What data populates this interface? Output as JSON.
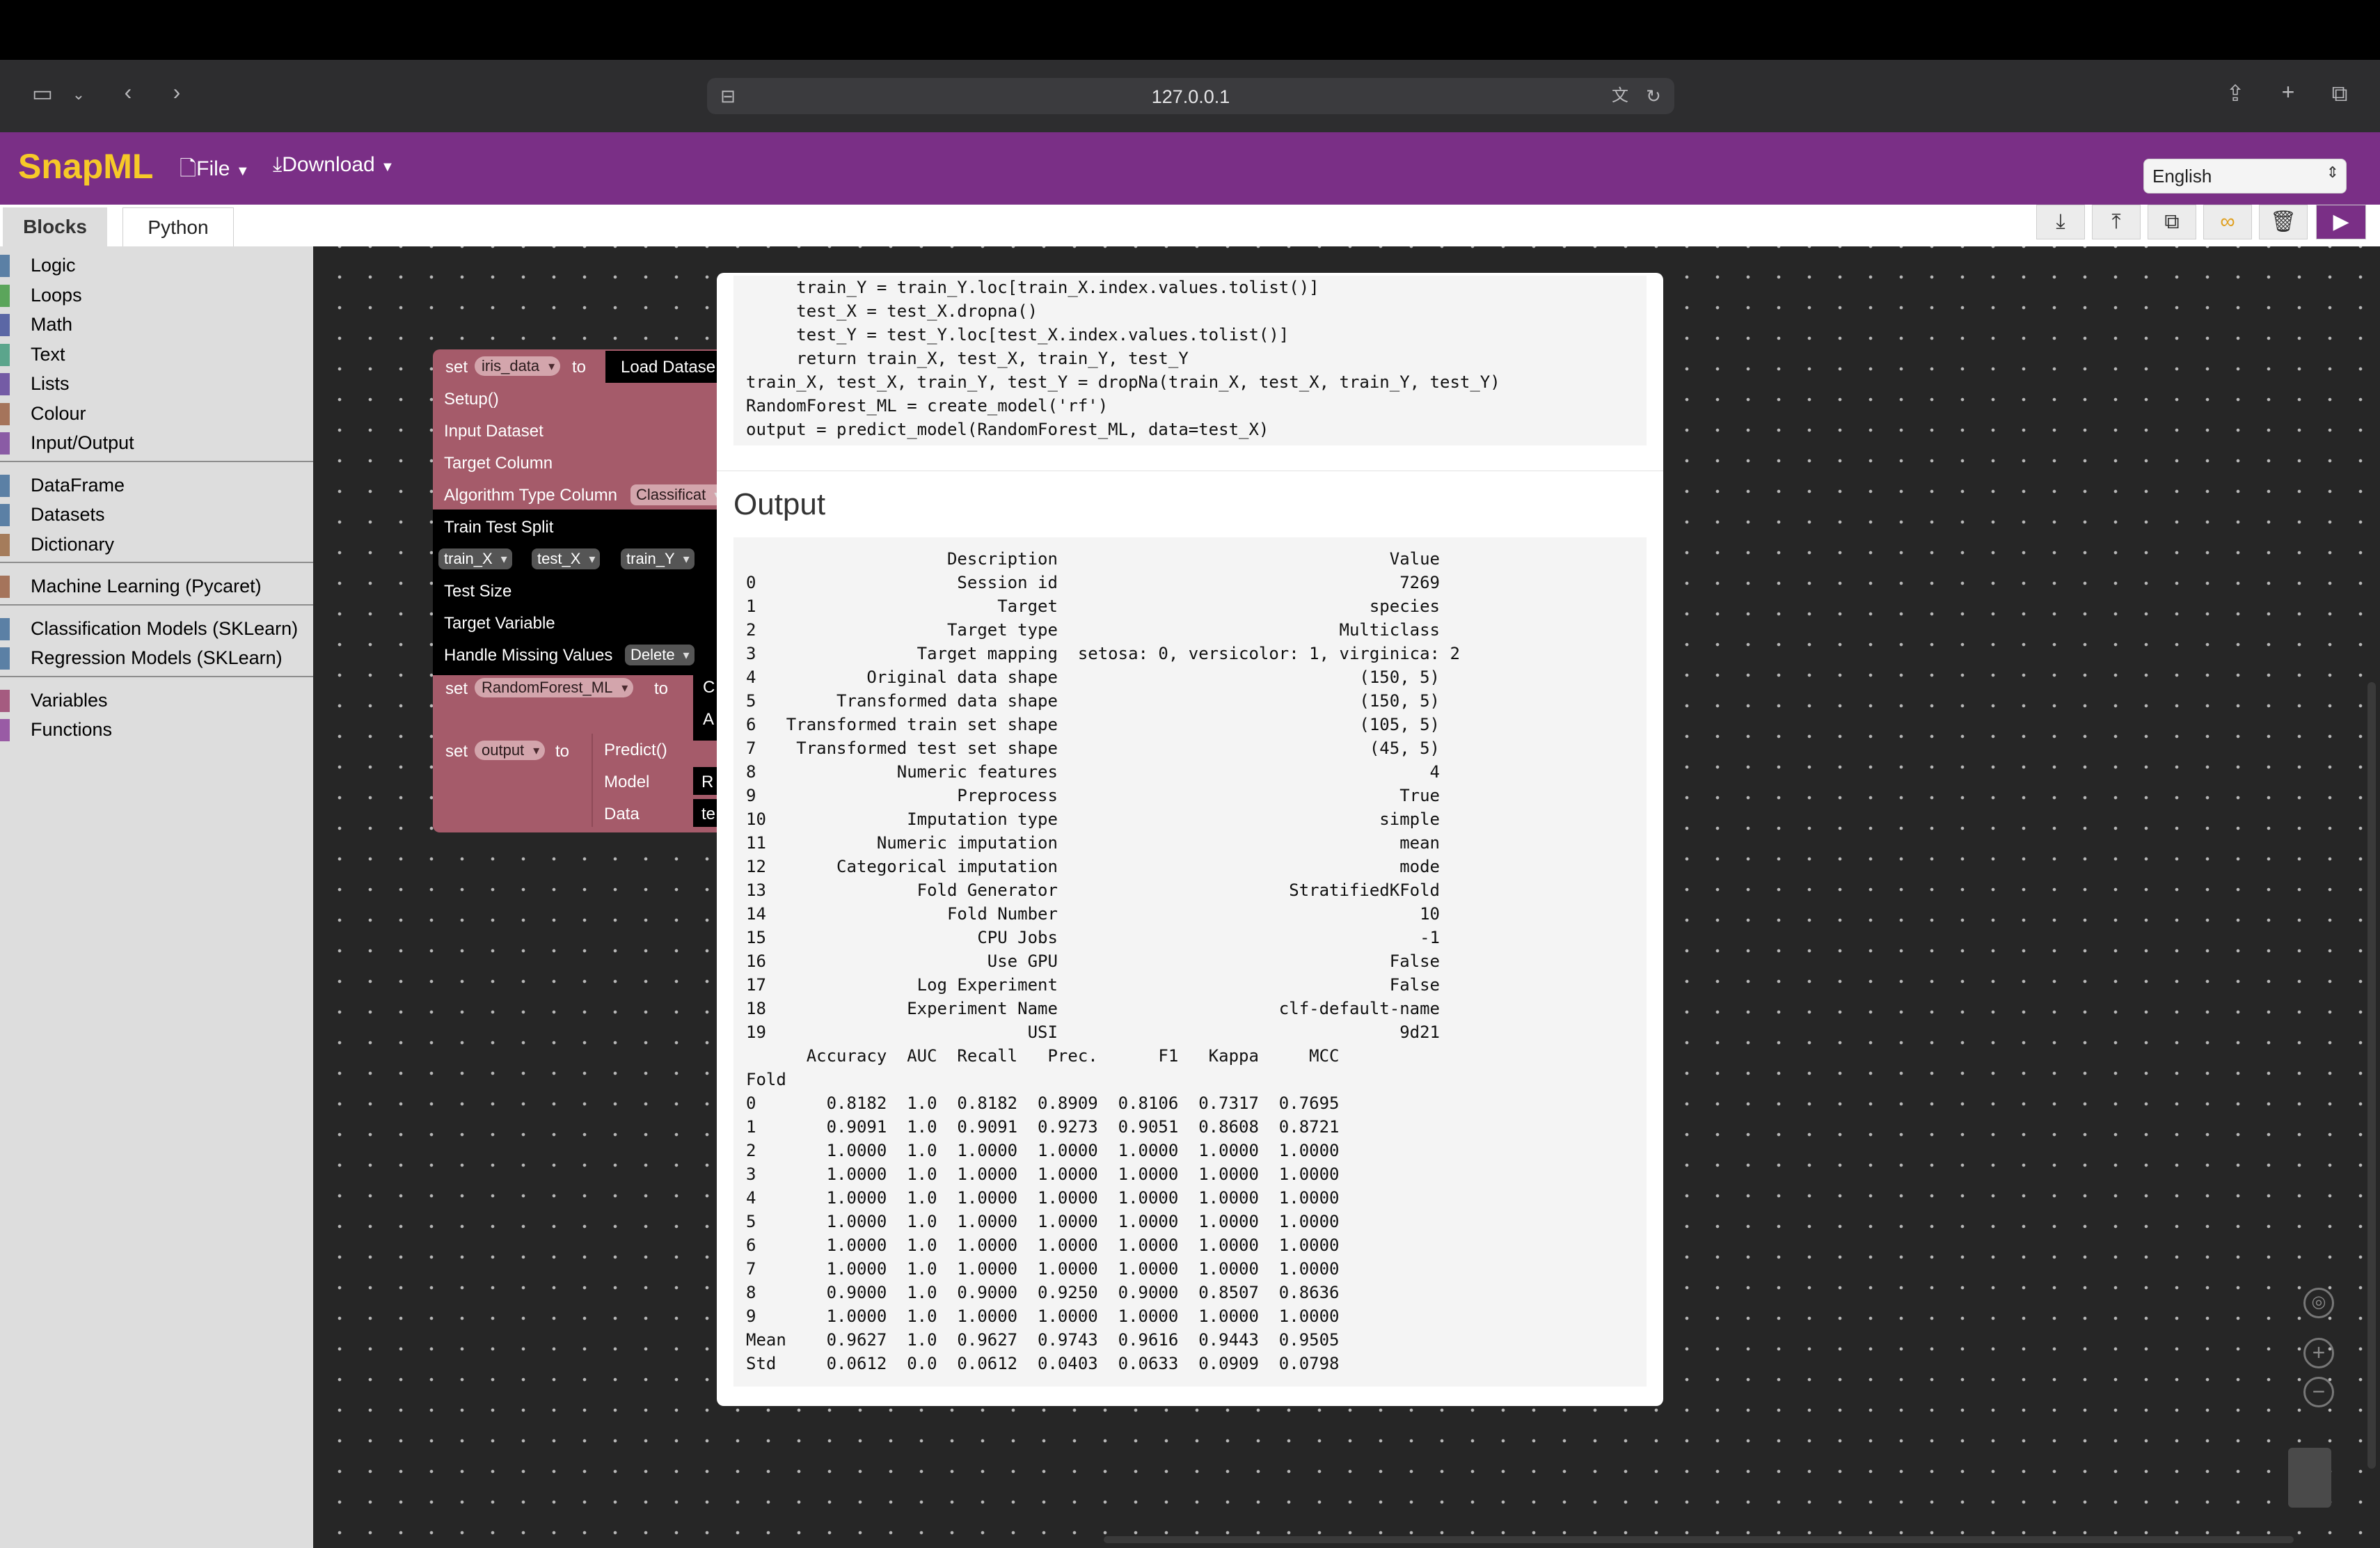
{
  "browser": {
    "url": "127.0.0.1"
  },
  "app": {
    "title": "SnapML",
    "menu": {
      "file": "File",
      "download": "Download"
    },
    "language": "English"
  },
  "tabs": {
    "blocks": "Blocks",
    "python": "Python"
  },
  "sidebar": {
    "groups": [
      [
        {
          "label": "Logic",
          "color": "#5b80a5"
        },
        {
          "label": "Loops",
          "color": "#5ba55b"
        },
        {
          "label": "Math",
          "color": "#5b67a5"
        },
        {
          "label": "Text",
          "color": "#5ba58c"
        },
        {
          "label": "Lists",
          "color": "#745ba5"
        },
        {
          "label": "Colour",
          "color": "#a5745b"
        },
        {
          "label": "Input/Output",
          "color": "#8a5ba5"
        }
      ],
      [
        {
          "label": "DataFrame",
          "color": "#5b80a5"
        },
        {
          "label": "Datasets",
          "color": "#5b80a5"
        },
        {
          "label": "Dictionary",
          "color": "#a57c5b"
        }
      ],
      [
        {
          "label": "Machine Learning (Pycaret)",
          "color": "#a5745b"
        }
      ],
      [
        {
          "label": "Classification Models (SKLearn)",
          "color": "#5b80a5"
        },
        {
          "label": "Regression Models (SKLearn)",
          "color": "#5b80a5"
        }
      ],
      [
        {
          "label": "Variables",
          "color": "#a55b80"
        },
        {
          "label": "Functions",
          "color": "#995ba5"
        }
      ]
    ]
  },
  "blocks": {
    "set": "set",
    "to": "to",
    "iris_var": "iris_data",
    "load_dataset": "Load Datase",
    "setup": "Setup()",
    "input_dataset": "Input Dataset",
    "target_column": "Target Column",
    "algo_type": "Algorithm Type Column",
    "algo_value": "Classificat",
    "tts": "Train Test Split",
    "train_x": "train_X",
    "test_x": "test_X",
    "train_y": "train_Y",
    "test_size": "Test Size",
    "target_variable": "Target Variable",
    "missing": "Handle Missing Values",
    "missing_value": "Delete",
    "rf_var": "RandomForest_ML",
    "rf_c": "C",
    "rf_a": "A",
    "output_var": "output",
    "predict": "Predict()",
    "model": "Model",
    "model_val": "R",
    "data": "Data",
    "data_val": "te"
  },
  "code": {
    "lines": [
      "     train_Y = train_Y.loc[train_X.index.values.tolist()]",
      "     test_X = test_X.dropna()",
      "     test_Y = test_Y.loc[test_X.index.values.tolist()]",
      "     return train_X, test_X, train_Y, test_Y",
      "train_X, test_X, train_Y, test_Y = dropNa(train_X, test_X, train_Y, test_Y)",
      "RandomForest_ML = create_model('rf')",
      "output = predict_model(RandomForest_ML, data=test_X)"
    ]
  },
  "output": {
    "title": "Output",
    "lines": [
      "                    Description                                 Value",
      "0                    Session id                                  7269",
      "1                        Target                               species",
      "2                   Target type                            Multiclass",
      "3                Target mapping  setosa: 0, versicolor: 1, virginica: 2",
      "4           Original data shape                              (150, 5)",
      "5        Transformed data shape                              (150, 5)",
      "6   Transformed train set shape                              (105, 5)",
      "7    Transformed test set shape                               (45, 5)",
      "8              Numeric features                                     4",
      "9                    Preprocess                                  True",
      "10              Imputation type                                simple",
      "11           Numeric imputation                                  mean",
      "12       Categorical imputation                                  mode",
      "13               Fold Generator                       StratifiedKFold",
      "14                  Fold Number                                    10",
      "15                     CPU Jobs                                    -1",
      "16                      Use GPU                                 False",
      "17               Log Experiment                                 False",
      "18              Experiment Name                      clf-default-name",
      "19                          USI                                  9d21",
      "      Accuracy  AUC  Recall   Prec.      F1   Kappa     MCC",
      "Fold",
      "0       0.8182  1.0  0.8182  0.8909  0.8106  0.7317  0.7695",
      "1       0.9091  1.0  0.9091  0.9273  0.9051  0.8608  0.8721",
      "2       1.0000  1.0  1.0000  1.0000  1.0000  1.0000  1.0000",
      "3       1.0000  1.0  1.0000  1.0000  1.0000  1.0000  1.0000",
      "4       1.0000  1.0  1.0000  1.0000  1.0000  1.0000  1.0000",
      "5       1.0000  1.0  1.0000  1.0000  1.0000  1.0000  1.0000",
      "6       1.0000  1.0  1.0000  1.0000  1.0000  1.0000  1.0000",
      "7       1.0000  1.0  1.0000  1.0000  1.0000  1.0000  1.0000",
      "8       0.9000  1.0  0.9000  0.9250  0.9000  0.8507  0.8636",
      "9       1.0000  1.0  1.0000  1.0000  1.0000  1.0000  1.0000",
      "Mean    0.9627  1.0  0.9627  0.9743  0.9616  0.9443  0.9505",
      "Std     0.0612  0.0  0.0612  0.0403  0.0633  0.0909  0.0798"
    ]
  },
  "colors": {
    "appbar": "#7a2f86",
    "logo": "#f6c928",
    "block": "#a55b6a",
    "workspace": "#262626"
  }
}
